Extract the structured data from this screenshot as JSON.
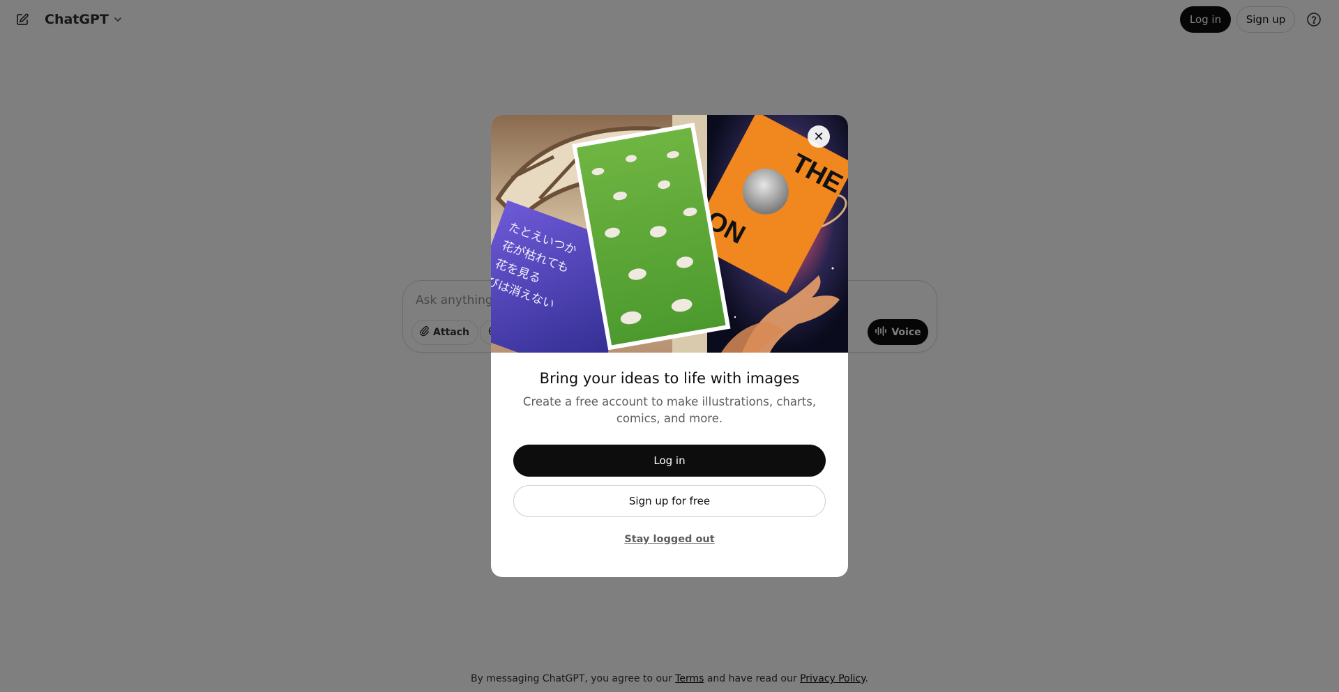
{
  "header": {
    "app_title": "ChatGPT",
    "login_label": "Log in",
    "signup_label": "Sign up"
  },
  "composer": {
    "placeholder": "Ask anything",
    "attach_label": "Attach",
    "voice_label": "Voice"
  },
  "footer": {
    "prefix": "By messaging ChatGPT, you agree to our ",
    "terms_label": "Terms",
    "middle": " and have read our ",
    "privacy_label": "Privacy Policy",
    "suffix": "."
  },
  "modal": {
    "title": "Bring your ideas to life with images",
    "subtitle": "Create a free account to make illustrations, charts, comics, and more.",
    "login_label": "Log in",
    "signup_label": "Sign up for free",
    "stay_label": "Stay logged out",
    "close_glyph": "✕",
    "hero": {
      "poster_text_1": "THE",
      "poster_text_2": "ON",
      "jp_line_1": "たとえいつか",
      "jp_line_2": "花が枯れても",
      "jp_line_3": "花を見る",
      "jp_line_4": "喜びは消えない"
    }
  },
  "colors": {
    "primary_button": "#0d0d0d",
    "overlay": "rgba(0,0,0,0.5)",
    "poster_orange": "#f0871f",
    "card_purple": "#5a46c8",
    "field_green": "#5fa83a"
  },
  "icons": [
    "new-chat-icon",
    "chevron-down-icon",
    "help-icon",
    "paperclip-icon",
    "globe-icon",
    "waveform-icon",
    "close-icon"
  ]
}
